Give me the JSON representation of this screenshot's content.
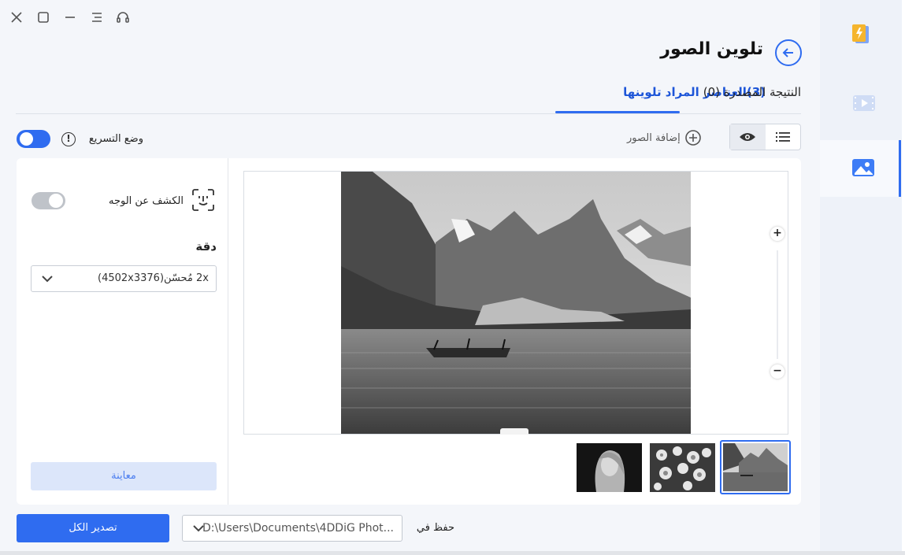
{
  "window": {
    "title": "تلوين الصور"
  },
  "tabs": {
    "active_label": "(3)العناصر المراد تلوينها",
    "inactive_label": "النتيجة المصدرة (0)"
  },
  "toolbar": {
    "accel_label": "وضع التسريع",
    "info_glyph": "!",
    "add_images_label": "إضافة الصور",
    "accel_mode_on": true
  },
  "settings": {
    "face_label": "الكشف عن الوجه",
    "face_detection_on": false,
    "resolution_label": "دقة",
    "resolution_value": "2x مُحسّن(4502x3376)",
    "preview_label": "معاينة"
  },
  "preview": {
    "zoom_in": "+",
    "zoom_out": "−",
    "thumbnails": [
      "mountain-lake",
      "flowers",
      "portrait"
    ],
    "selected_thumbnail": "mountain-lake"
  },
  "footer": {
    "export_label": "تصدير الكل",
    "save_in_label": "حفظ في",
    "save_path": "D:\\Users\\Documents\\4DDiG Phot..."
  },
  "sidebar": {
    "items": [
      "repair-icon",
      "video-icon",
      "image-icon"
    ],
    "active_item": "image-icon"
  },
  "colors": {
    "accent": "#2f6cf0",
    "panel_bg": "#f4f6fa",
    "sidebar_bg": "#eef2f9"
  }
}
